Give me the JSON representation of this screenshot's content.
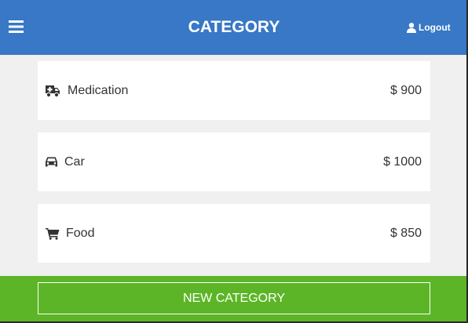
{
  "header": {
    "title": "CATEGORY",
    "logout_label": "Logout",
    "menu_icon": "hamburger-menu-icon",
    "logout_icon": "user-icon"
  },
  "categories": [
    {
      "name": "Medication",
      "amount": "$ 900",
      "icon": "ambulance-icon"
    },
    {
      "name": "Car",
      "amount": "$ 1000",
      "icon": "car-icon"
    },
    {
      "name": "Food",
      "amount": "$ 850",
      "icon": "shopping-cart-icon"
    }
  ],
  "footer": {
    "new_category_label": "NEW CATEGORY"
  },
  "colors": {
    "header_bg": "#3878c6",
    "footer_bg": "#5cb526",
    "page_bg": "#f0f0f0",
    "card_bg": "#ffffff",
    "text": "#333333"
  }
}
